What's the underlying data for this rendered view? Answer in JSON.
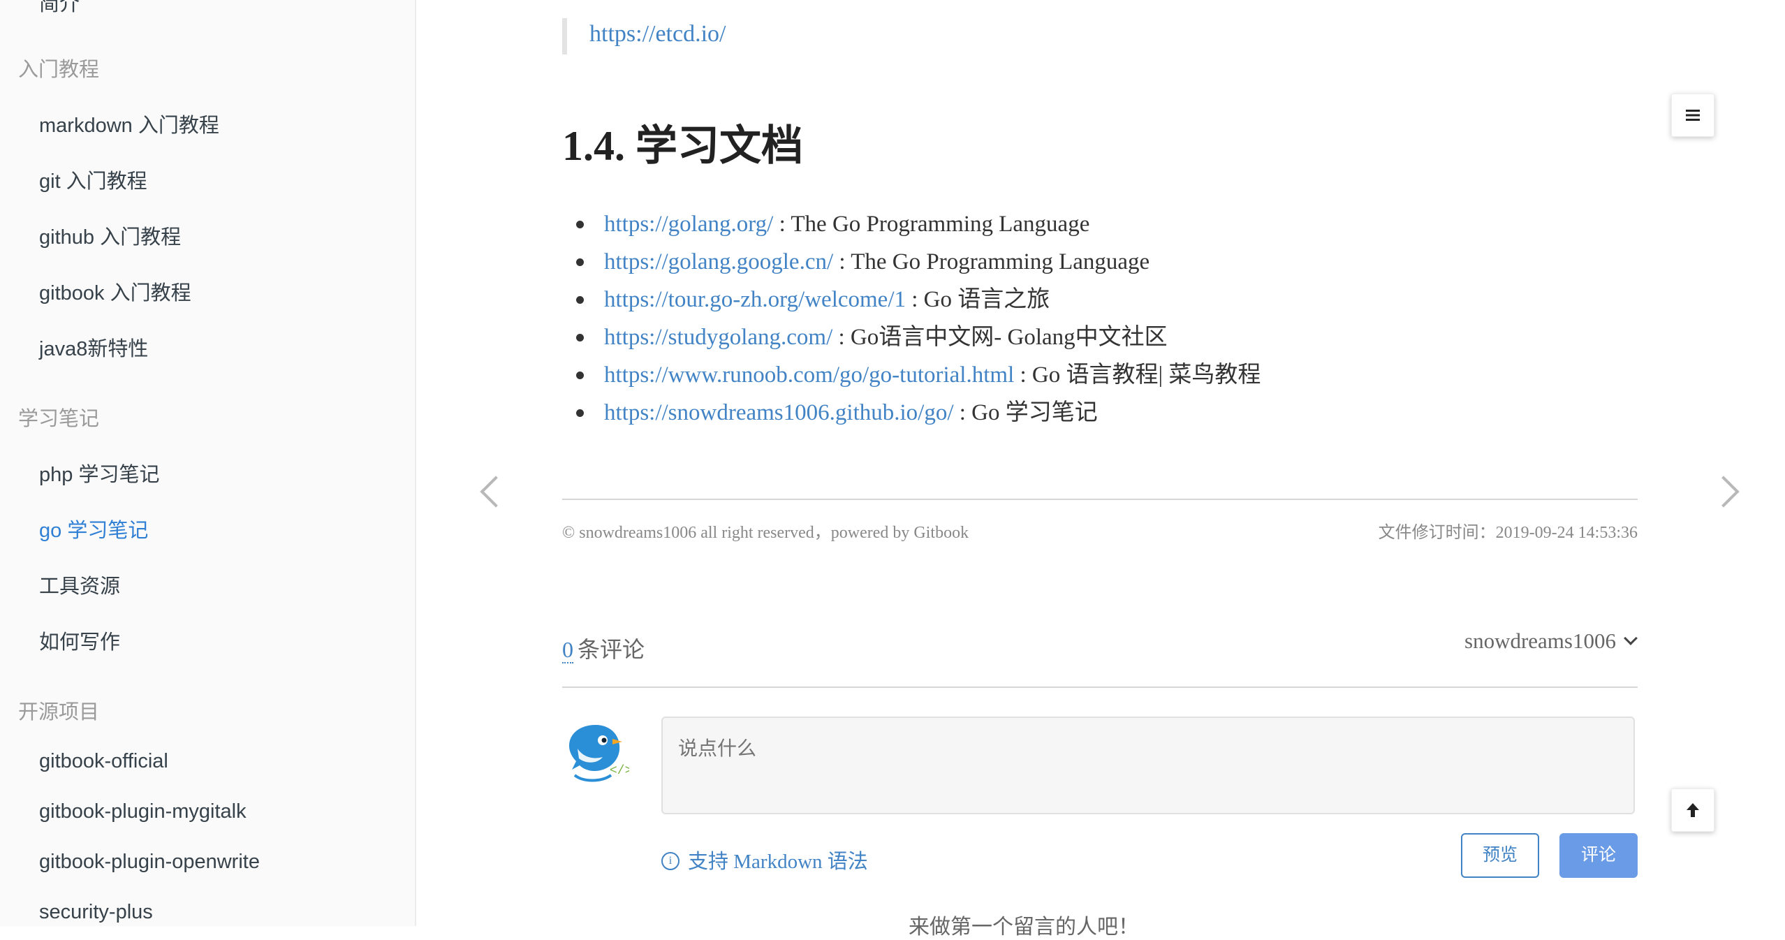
{
  "sidebar": {
    "partial_top": "简介",
    "groups": [
      {
        "header": "入门教程",
        "items": [
          "markdown 入门教程",
          "git 入门教程",
          "github 入门教程",
          "gitbook 入门教程",
          "java8新特性"
        ]
      },
      {
        "header": "学习笔记",
        "items": [
          "php 学习笔记",
          "go 学习笔记",
          "工具资源",
          "如何写作"
        ],
        "active": "go 学习笔记"
      },
      {
        "header": "开源项目",
        "items": [
          "gitbook-official",
          "gitbook-plugin-mygitalk",
          "gitbook-plugin-openwrite",
          "security-plus"
        ]
      }
    ]
  },
  "content": {
    "quote_link": "https://etcd.io/",
    "section_title": "1.4. 学习文档",
    "docs": [
      {
        "url": "https://golang.org/",
        "desc": " : The Go Programming Language"
      },
      {
        "url": "https://golang.google.cn/",
        "desc": " : The Go Programming Language"
      },
      {
        "url": "https://tour.go-zh.org/welcome/1",
        "desc": " : Go 语言之旅"
      },
      {
        "url": "https://studygolang.com/",
        "desc": " : Go语言中文网- Golang中文社区"
      },
      {
        "url": "https://www.runoob.com/go/go-tutorial.html",
        "desc": " : Go 语言教程| 菜鸟教程"
      },
      {
        "url": "https://snowdreams1006.github.io/go/",
        "desc": " : Go 学习笔记"
      }
    ]
  },
  "footer": {
    "copyright": "© snowdreams1006 all right reserved，powered by Gitbook",
    "modified_label": "文件修订时间：",
    "modified_time": "2019-09-24 14:53:36"
  },
  "comments": {
    "count": "0",
    "count_label": "条评论",
    "user": "snowdreams1006",
    "placeholder": "说点什么",
    "markdown_hint": "支持 Markdown 语法",
    "preview_label": "预览",
    "submit_label": "评论",
    "empty_message": "来做第一个留言的人吧！"
  },
  "icons": {
    "menu": "menu-icon",
    "back_to_top": "arrow-up-icon",
    "prev": "chevron-left-icon",
    "next": "chevron-right-icon",
    "info": "info-icon",
    "avatar": "bird-avatar-icon"
  },
  "colors": {
    "link": "#4183c4",
    "active_nav": "#2f7fd4",
    "submit_button": "#6a9be6",
    "avatar": "#2a8fd6"
  }
}
